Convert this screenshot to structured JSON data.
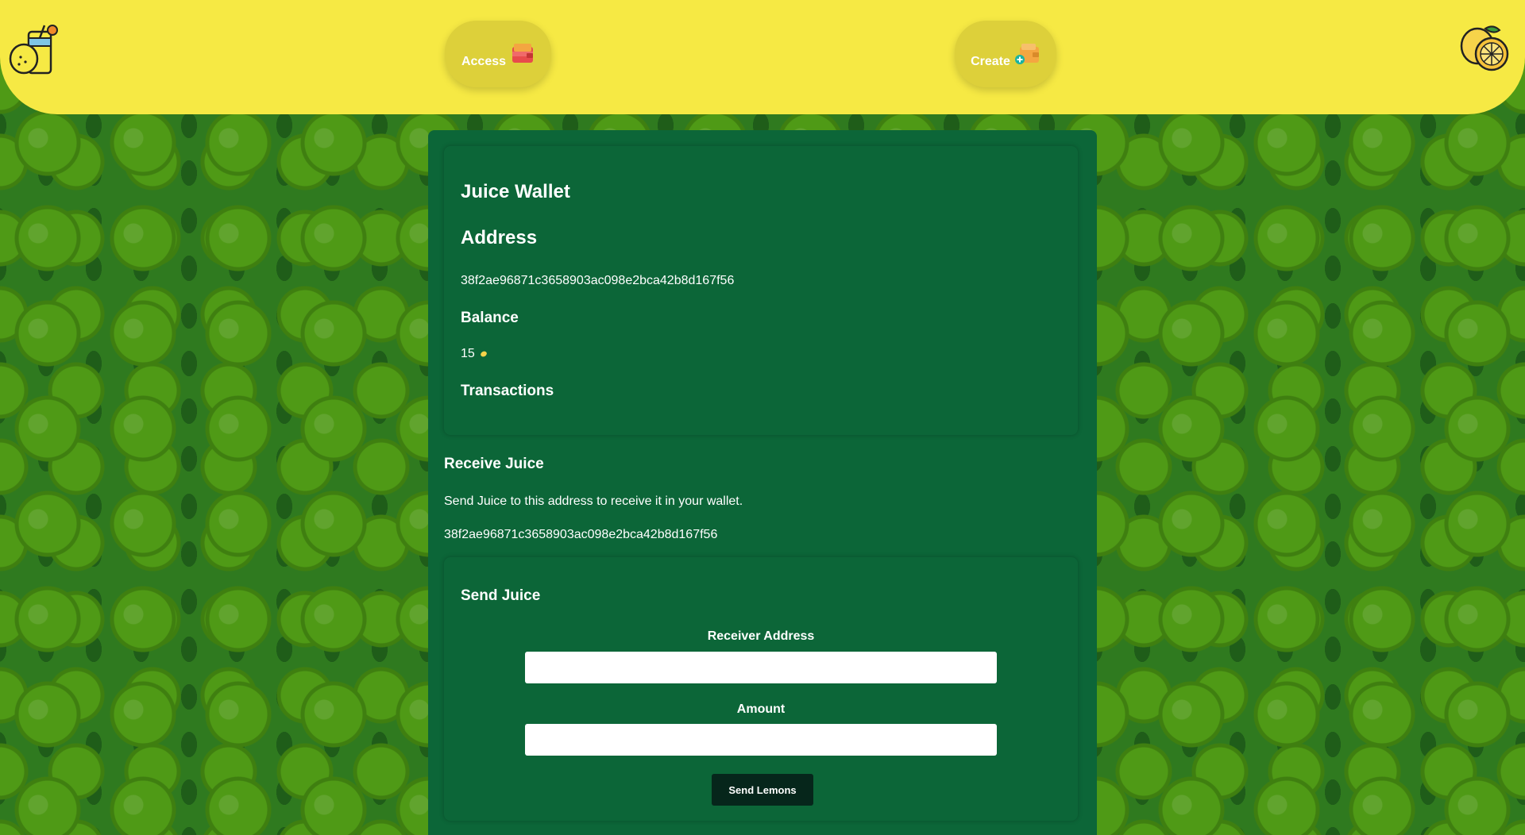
{
  "header": {
    "left_logo_icon": "lemonade-jar-icon",
    "right_logo_icon": "lemon-slice-icon",
    "access_label": "Access",
    "access_icon": "wallet-icon",
    "create_label": "Create",
    "create_icon": "wallet-add-icon"
  },
  "wallet": {
    "title": "Juice Wallet",
    "address_heading": "Address",
    "address_value": "38f2ae96871c3658903ac098e2bca42b8d167f56",
    "balance_heading": "Balance",
    "balance_value": "15",
    "balance_icon": "lemon-coin-icon",
    "transactions_heading": "Transactions"
  },
  "receive": {
    "heading": "Receive Juice",
    "description": "Send Juice to this address to receive it in your wallet.",
    "address_value": "38f2ae96871c3658903ac098e2bca42b8d167f56"
  },
  "send": {
    "heading": "Send Juice",
    "receiver_label": "Receiver Address",
    "receiver_value": "",
    "amount_label": "Amount",
    "amount_value": "",
    "button_label": "Send Lemons"
  },
  "colors": {
    "header_bg": "#f6e944",
    "nav_button_bg": "#ddd03a",
    "panel_bg": "#0c6638",
    "send_button_bg": "#06261b",
    "page_bg": "#2f7a1f"
  }
}
